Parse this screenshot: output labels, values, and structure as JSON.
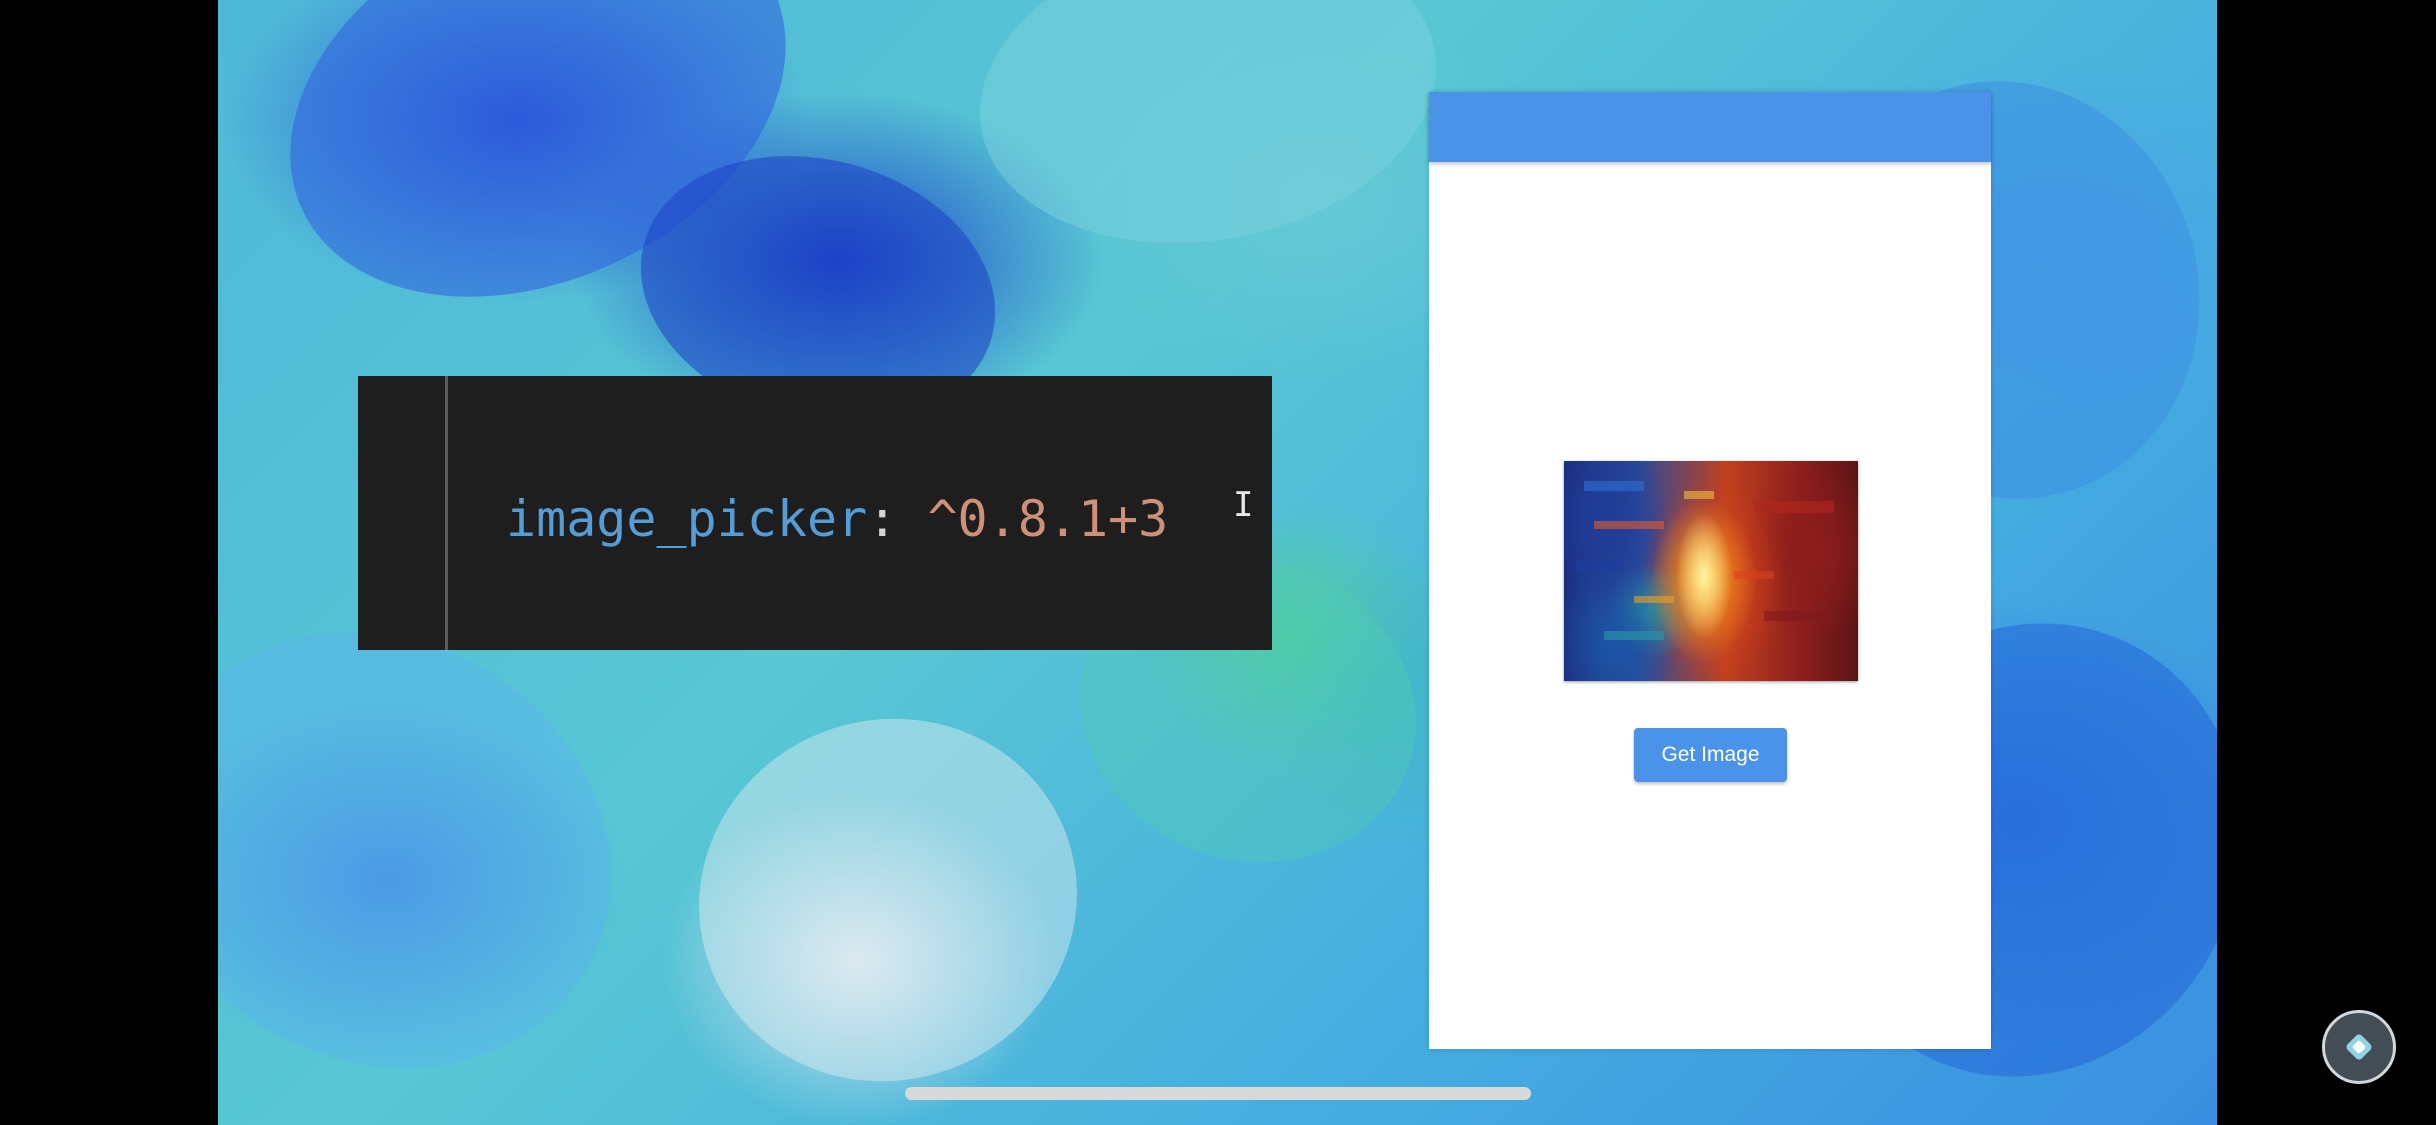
{
  "code_snippet": {
    "key": "image_picker",
    "colon": ":",
    "value": " ^0.8.1+3"
  },
  "text_cursor": {
    "glyph": "I"
  },
  "app": {
    "app_bar_title": "",
    "get_image_button_label": "Get Image",
    "accent_color": "#4b93e8"
  },
  "icons": {
    "text_cursor": "i-beam-cursor-icon",
    "floating_button": "assistive-touch-icon"
  }
}
